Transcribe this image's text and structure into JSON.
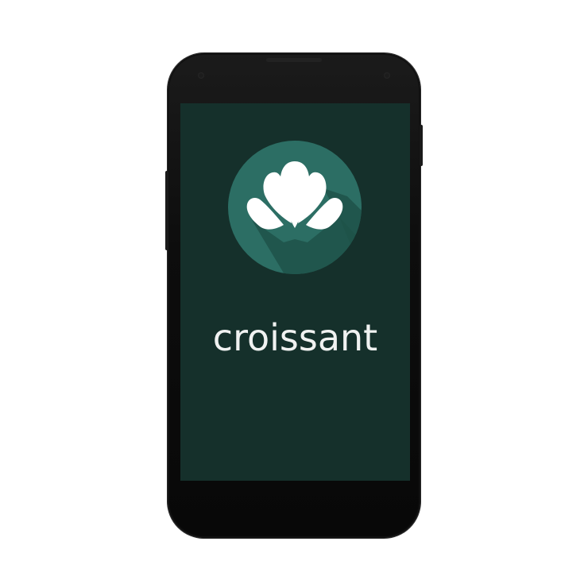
{
  "app": {
    "name": "croissant"
  },
  "splash": {
    "wordmark": "croissant",
    "logo_icon": "croissant-icon"
  },
  "colors": {
    "screen_background": "#15302b",
    "logo_circle": "#2c6e64",
    "logo_shadow": "#1e5249",
    "logo_glyph": "#ffffff",
    "wordmark": "#f0f2f1",
    "device_body": "#0d0d0d"
  }
}
